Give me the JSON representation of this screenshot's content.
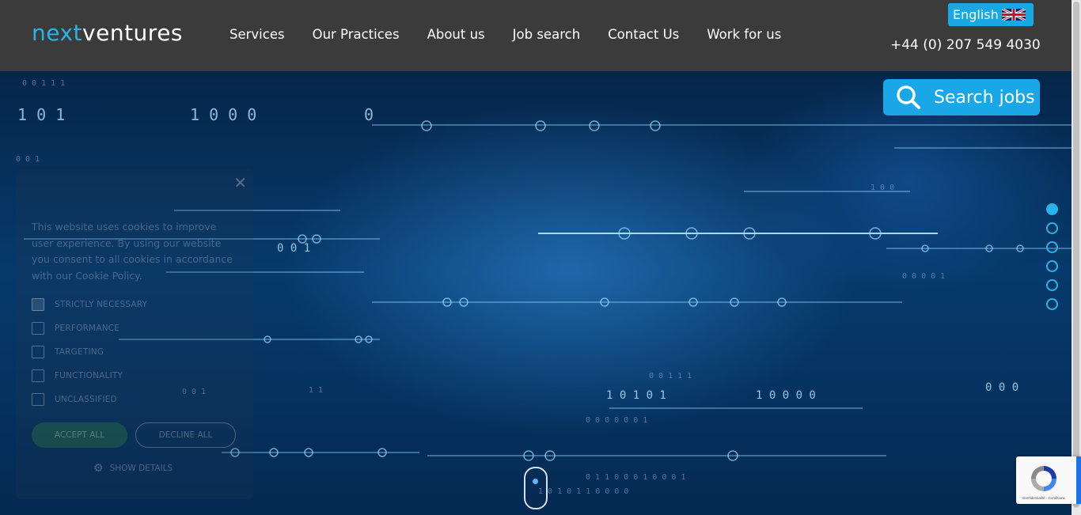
{
  "header": {
    "logo_part1": "next",
    "logo_part2": "ventures",
    "nav": [
      {
        "label": "Services"
      },
      {
        "label": "Our Practices"
      },
      {
        "label": "About us"
      },
      {
        "label": "Job search"
      },
      {
        "label": "Contact Us"
      },
      {
        "label": "Work for us"
      }
    ],
    "language": "English",
    "flag_icon": "uk-flag-icon",
    "phone": "+44 (0) 207 549 4030"
  },
  "hero": {
    "search_button": "Search jobs",
    "search_icon": "magnifier-icon",
    "slides_total": 6,
    "active_slide": 1,
    "scroll_icon": "mouse-scroll-icon"
  },
  "cookie_banner": {
    "message": "This website uses cookies to improve user experience. By using our website you consent to all cookies in accordance with our",
    "policy_link": "Cookie Policy",
    "policy_suffix": ".",
    "options": [
      {
        "label": "STRICTLY NECESSARY",
        "checked": true
      },
      {
        "label": "PERFORMANCE",
        "checked": false
      },
      {
        "label": "TARGETING",
        "checked": false
      },
      {
        "label": "FUNCTIONALITY",
        "checked": false
      },
      {
        "label": "UNCLASSIFIED",
        "checked": false
      }
    ],
    "accept_label": "ACCEPT ALL",
    "decline_label": "DECLINE ALL",
    "details_label": "SHOW DETAILS"
  },
  "recaptcha": {
    "terms": "Confidentialité - Conditions"
  },
  "colors": {
    "header_bg": "#3b3b3b",
    "accent": "#19a7e7"
  }
}
